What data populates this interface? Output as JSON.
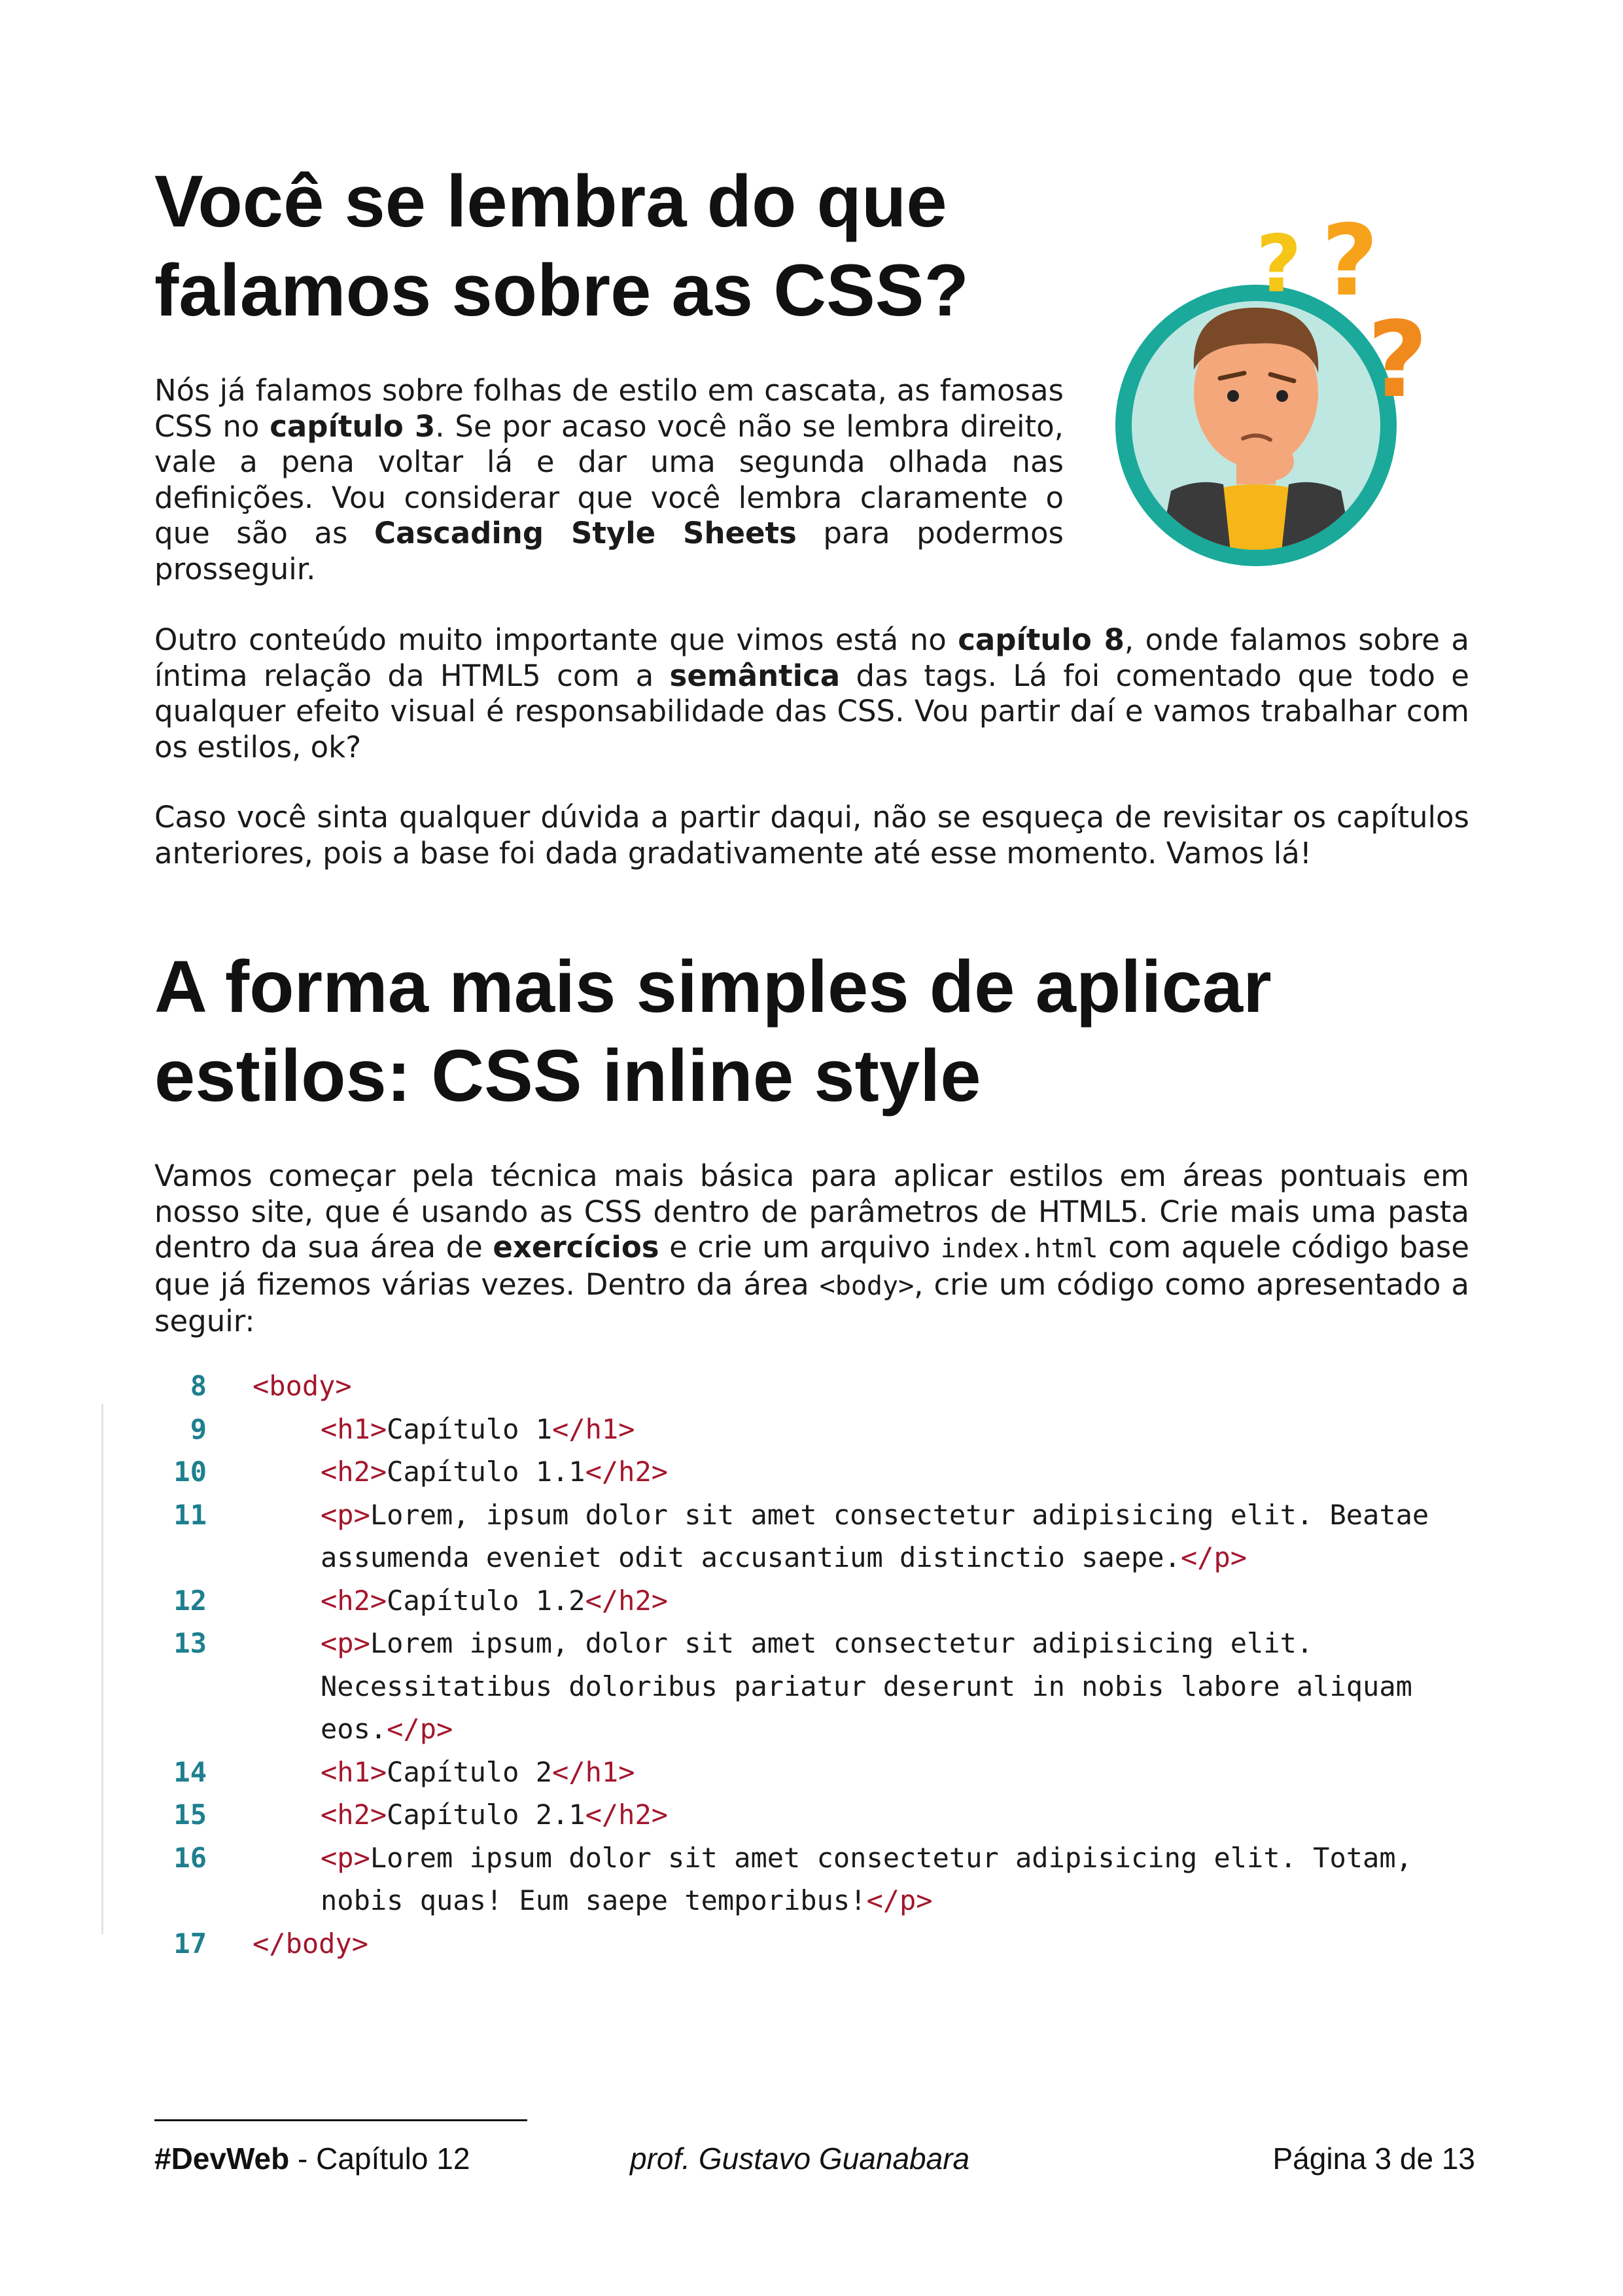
{
  "section1": {
    "title_line1": "Você se lembra do que",
    "title_line2": "falamos sobre as CSS?",
    "p1": {
      "t1": "Nós já falamos sobre folhas de estilo em cascata, as famosas CSS no ",
      "b1": "capítulo 3",
      "t2": ". Se por acaso você não se lembra direito, vale a pena voltar lá e dar uma segunda olhada nas definições. Vou considerar que você lembra claramente o que são as ",
      "b2": "Cascading Style Sheets",
      "t3": " para podermos prosseguir."
    },
    "p2": {
      "t1": "Outro conteúdo muito importante que vimos está no ",
      "b1": "capítulo 8",
      "t2": ", onde falamos sobre a íntima relação da HTML5 com a ",
      "b2": "semântica",
      "t3": " das tags. Lá foi comentado que todo e qualquer efeito visual é responsabilidade das CSS. Vou partir daí e vamos trabalhar com os estilos, ok?"
    },
    "p3": "Caso você sinta qualquer dúvida a partir daqui, não se esqueça de revisitar os capítulos anteriores, pois a base foi dada gradativamente até esse momento. Vamos lá!"
  },
  "section2": {
    "title_line1": "A forma mais simples de aplicar",
    "title_line2": "estilos: CSS inline style",
    "p1": {
      "t1": "Vamos começar pela técnica mais básica para aplicar estilos em áreas pontuais em nosso site, que é usando as CSS dentro de parâmetros de HTML5. Crie mais uma pasta dentro da sua área de ",
      "b1": "exercícios",
      "t2": " e crie um arquivo ",
      "c1": "index.html",
      "t3": " com aquele código base que já fizemos várias vezes. Dentro da área ",
      "c2": "<body>",
      "t4": ", crie um código como apresentado a seguir:"
    }
  },
  "code": {
    "lines": [
      {
        "n": "8",
        "indent": 0,
        "tokens": [
          {
            "k": "tag",
            "v": "<body>"
          }
        ]
      },
      {
        "n": "9",
        "indent": 1,
        "tokens": [
          {
            "k": "tag",
            "v": "<h1>"
          },
          {
            "k": "text",
            "v": "Capítulo 1"
          },
          {
            "k": "tag",
            "v": "</h1>"
          }
        ]
      },
      {
        "n": "10",
        "indent": 1,
        "tokens": [
          {
            "k": "tag",
            "v": "<h2>"
          },
          {
            "k": "text",
            "v": "Capítulo 1.1"
          },
          {
            "k": "tag",
            "v": "</h2>"
          }
        ]
      },
      {
        "n": "11",
        "indent": 1,
        "tokens": [
          {
            "k": "tag",
            "v": "<p>"
          },
          {
            "k": "text",
            "v": "Lorem, ipsum dolor sit amet consectetur adipisicing elit. Beatae"
          }
        ]
      },
      {
        "n": "",
        "indent": 1,
        "tokens": [
          {
            "k": "text",
            "v": "assumenda eveniet odit accusantium distinctio saepe."
          },
          {
            "k": "tag",
            "v": "</p>"
          }
        ]
      },
      {
        "n": "12",
        "indent": 1,
        "tokens": [
          {
            "k": "tag",
            "v": "<h2>"
          },
          {
            "k": "text",
            "v": "Capítulo 1.2"
          },
          {
            "k": "tag",
            "v": "</h2>"
          }
        ]
      },
      {
        "n": "13",
        "indent": 1,
        "tokens": [
          {
            "k": "tag",
            "v": "<p>"
          },
          {
            "k": "text",
            "v": "Lorem ipsum, dolor sit amet consectetur adipisicing elit."
          }
        ]
      },
      {
        "n": "",
        "indent": 1,
        "tokens": [
          {
            "k": "text",
            "v": "Necessitatibus doloribus pariatur deserunt in nobis labore aliquam"
          }
        ]
      },
      {
        "n": "",
        "indent": 1,
        "tokens": [
          {
            "k": "text",
            "v": "eos."
          },
          {
            "k": "tag",
            "v": "</p>"
          }
        ]
      },
      {
        "n": "14",
        "indent": 1,
        "tokens": [
          {
            "k": "tag",
            "v": "<h1>"
          },
          {
            "k": "text",
            "v": "Capítulo 2"
          },
          {
            "k": "tag",
            "v": "</h1>"
          }
        ]
      },
      {
        "n": "15",
        "indent": 1,
        "tokens": [
          {
            "k": "tag",
            "v": "<h2>"
          },
          {
            "k": "text",
            "v": "Capítulo 2.1"
          },
          {
            "k": "tag",
            "v": "</h2>"
          }
        ]
      },
      {
        "n": "16",
        "indent": 1,
        "tokens": [
          {
            "k": "tag",
            "v": "<p>"
          },
          {
            "k": "text",
            "v": "Lorem ipsum dolor sit amet consectetur adipisicing elit. Totam,"
          }
        ]
      },
      {
        "n": "",
        "indent": 1,
        "tokens": [
          {
            "k": "text",
            "v": "nobis quas! Eum saepe temporibus!"
          },
          {
            "k": "tag",
            "v": "</p>"
          }
        ]
      },
      {
        "n": "17",
        "indent": 0,
        "tokens": [
          {
            "k": "tag",
            "v": "</body>"
          }
        ]
      }
    ]
  },
  "footer": {
    "brand": "#DevWeb",
    "chapter": " - Capítulo 12",
    "author": "prof. Gustavo Guanabara",
    "page": "Página 3 de 13"
  },
  "colors": {
    "code_tag": "#a3162c",
    "line_number": "#1e7f8f",
    "circle_ring": "#1aa99a",
    "circle_fill": "#bfe7e1",
    "question_marks": [
      "#f5c518",
      "#f7a21b",
      "#f08a1c"
    ]
  },
  "icons": {
    "illustration": "confused-person-icon"
  }
}
